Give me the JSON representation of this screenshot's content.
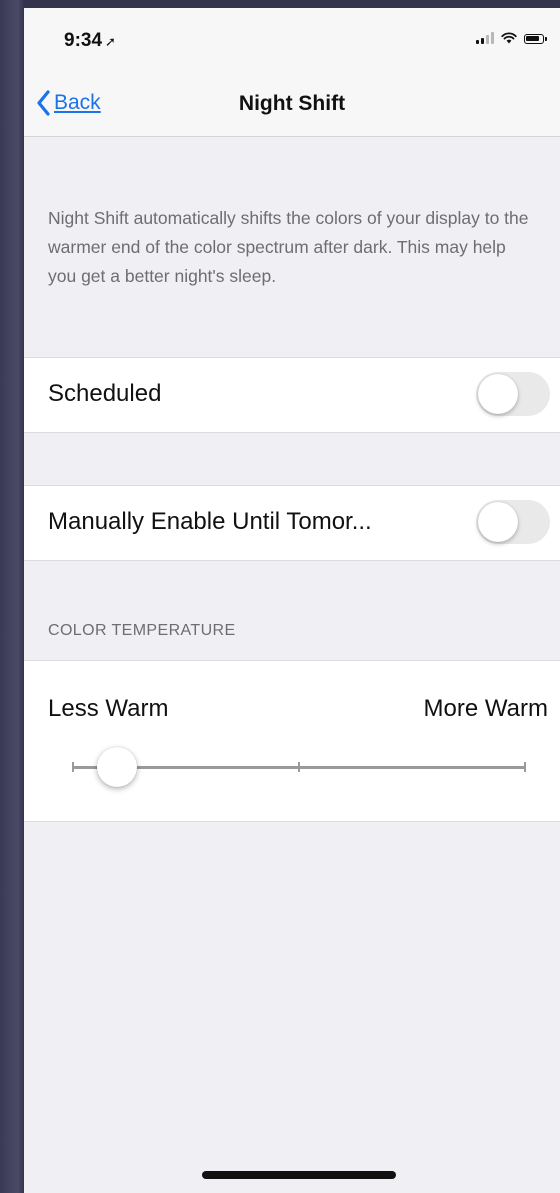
{
  "status_bar": {
    "time": "9:34",
    "location_glyph": "➚",
    "icons": [
      "signal-icon",
      "wifi-icon",
      "battery-icon"
    ],
    "signal_bars_filled": 2,
    "signal_bars_total": 4
  },
  "nav": {
    "back_label": "Back",
    "title": "Night Shift",
    "accent_color": "#1a73e8"
  },
  "description": "Night Shift automatically shifts the colors of your display to the warmer end of the color spectrum after dark. This may help you get a better night's sleep.",
  "settings": {
    "scheduled": {
      "label": "Scheduled",
      "enabled": false
    },
    "manual": {
      "label": "Manually Enable Until Tomor...",
      "enabled": false
    }
  },
  "color_temperature": {
    "section_header": "COLOR TEMPERATURE",
    "less_label": "Less Warm",
    "more_label": "More Warm",
    "value_fraction": 0.1
  }
}
